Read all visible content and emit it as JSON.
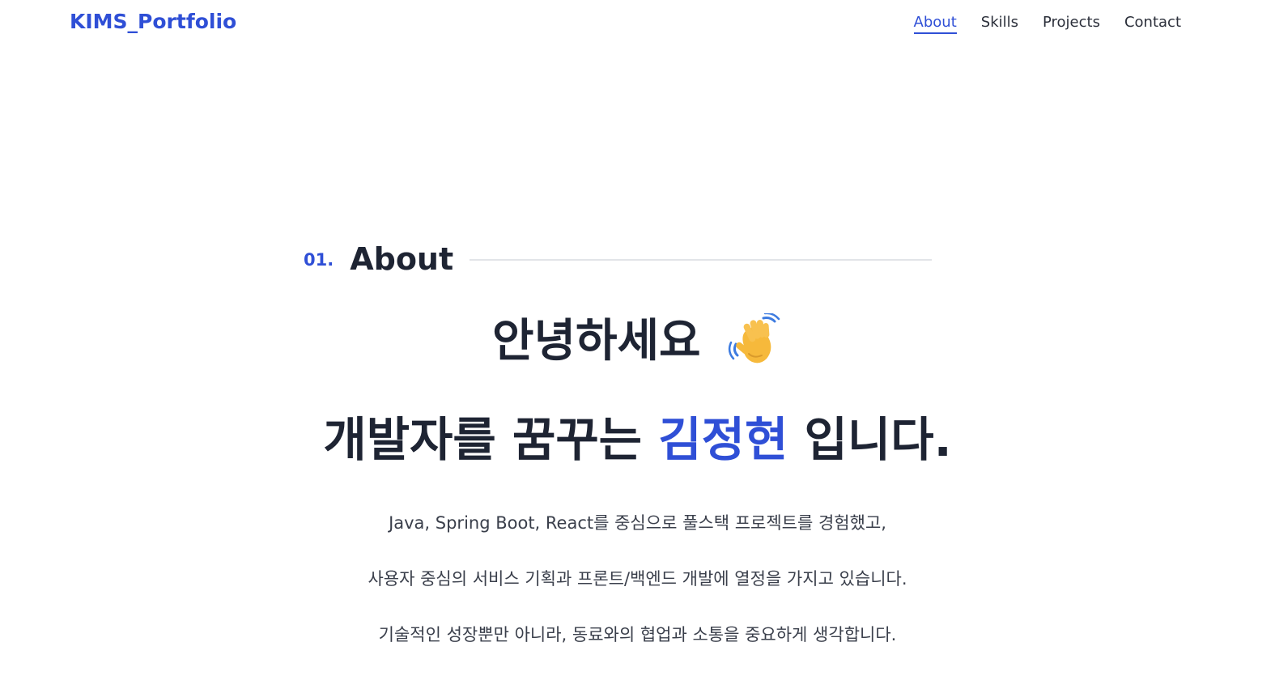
{
  "navbar": {
    "brand": "KIMS_Portfolio",
    "links": [
      {
        "label": "About",
        "active": true
      },
      {
        "label": "Skills",
        "active": false
      },
      {
        "label": "Projects",
        "active": false
      },
      {
        "label": "Contact",
        "active": false
      }
    ]
  },
  "section": {
    "number": "01.",
    "title": "About"
  },
  "hero": {
    "greeting": "안녕하세요",
    "greeting_icon": "waving-hand-icon",
    "intro_prefix": "개발자를 꿈꾸는",
    "intro_name": "김정현",
    "intro_suffix": "입니다."
  },
  "description": [
    "Java, Spring Boot, React를 중심으로 풀스택 프로젝트를 경험했고,",
    "사용자 중심의 서비스 기획과 프론트/백엔드 개발에 열정을 가지고 있습니다.",
    "기술적인 성장뿐만 아니라, 동료와의 협업과 소통을 중요하게 생각합니다."
  ],
  "colors": {
    "accent": "#2f4fd6",
    "text": "#1e2433",
    "body_text": "#3a3f4b",
    "rule": "#e2e4e8"
  }
}
